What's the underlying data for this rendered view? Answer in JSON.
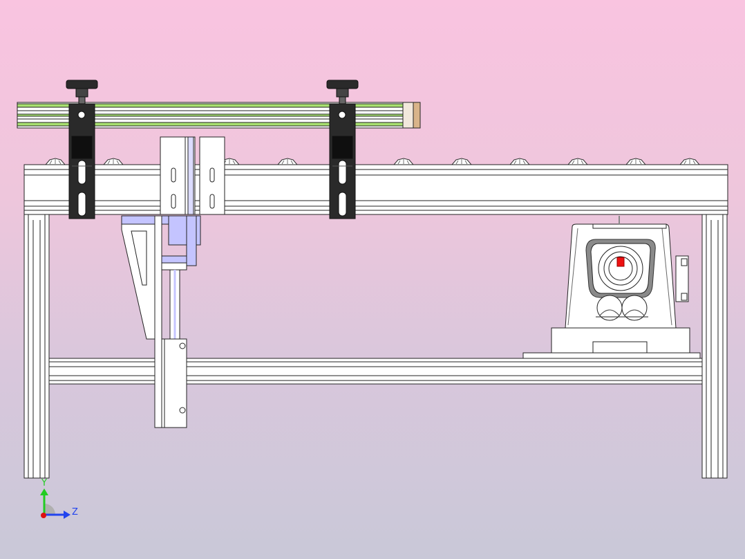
{
  "viewport": {
    "background_top": "#f9c4e0",
    "background_bottom": "#c9c8d8"
  },
  "triad": {
    "y_label": "Y",
    "z_label": "Z",
    "y_color": "#22cc22",
    "z_color": "#2244ee",
    "x_color": "#dd1111"
  },
  "colors": {
    "frame_fill": "#ffffff",
    "frame_stroke": "#222222",
    "guide_rail_green": "#a8e070",
    "clamp_dark": "#2a2a2a",
    "cylinder_blue": "#c4c4ff",
    "motor_marker_red": "#ee1111"
  },
  "components": [
    "aluminum-frame",
    "conveyor-rollers",
    "side-guide-rail",
    "guide-clamp-left",
    "guide-clamp-right",
    "stop-brackets",
    "pneumatic-cylinder",
    "gear-motor"
  ]
}
